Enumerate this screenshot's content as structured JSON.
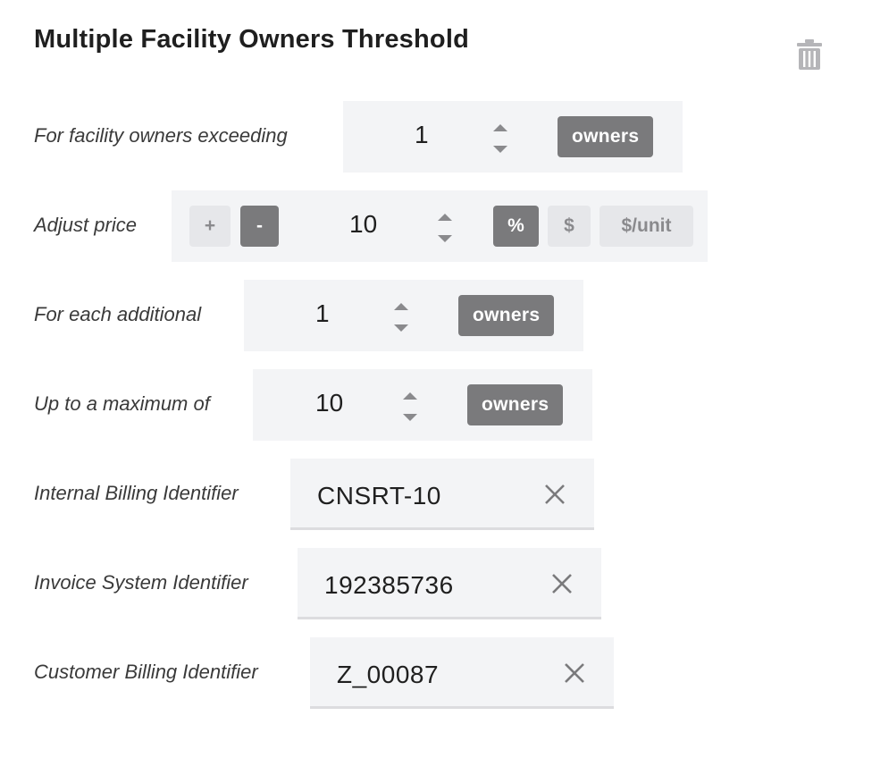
{
  "title": "Multiple Facility Owners Threshold",
  "icons": {
    "delete": "trash-icon",
    "spin": "spinner-arrows-icon",
    "clear": "close-icon"
  },
  "colors": {
    "panel_bg": "#f3f4f6",
    "active_tag": "#7a7a7c",
    "inactive_button": "#e6e7ea"
  },
  "exceeding": {
    "label": "For facility owners exceeding",
    "value": "1",
    "unit": "owners"
  },
  "adjust": {
    "label": "Adjust price",
    "plus": "+",
    "minus": "-",
    "value": "10",
    "percent": "%",
    "dollar": "$",
    "per_unit": "$/unit",
    "selected_sign": "-",
    "selected_mode": "%"
  },
  "additional": {
    "label": "For each additional",
    "value": "1",
    "unit": "owners"
  },
  "maximum": {
    "label": "Up to a maximum of",
    "value": "10",
    "unit": "owners"
  },
  "internal_billing": {
    "label": "Internal Billing Identifier",
    "value": "CNSRT-10"
  },
  "invoice_system": {
    "label": "Invoice System Identifier",
    "value": "192385736"
  },
  "customer_billing": {
    "label": "Customer Billing Identifier",
    "value": "Z_00087"
  }
}
